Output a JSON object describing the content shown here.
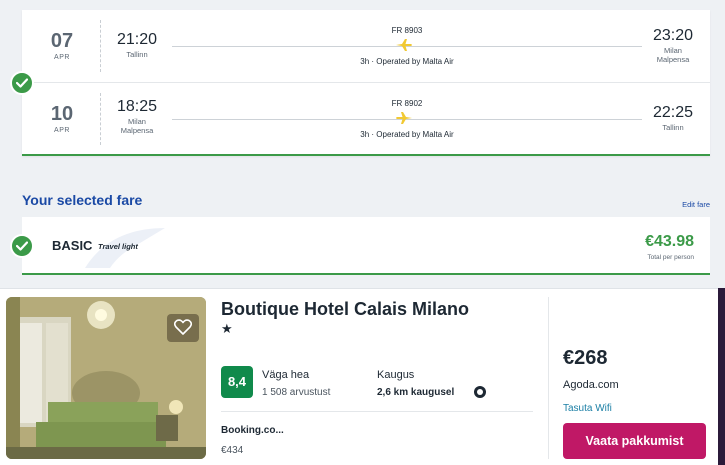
{
  "outbound": {
    "date_day": "07",
    "date_month": "APR",
    "departure_time": "21:20",
    "departure_city": "Tallinn",
    "flight_number": "FR 8903",
    "operated": "3h · Operated by Malta Air",
    "arrival_time": "23:20",
    "arrival_city_line1": "Milan",
    "arrival_city_line2": "Malpensa"
  },
  "return": {
    "date_day": "10",
    "date_month": "APR",
    "departure_time": "18:25",
    "departure_city_line1": "Milan",
    "departure_city_line2": "Malpensa",
    "flight_number": "FR 8902",
    "operated": "3h · Operated by Malta Air",
    "arrival_time": "22:25",
    "arrival_city": "Tallinn"
  },
  "fare": {
    "heading": "Your selected fare",
    "edit_label": "Edit fare",
    "name": "BASIC",
    "subtitle": "Travel light",
    "price": "€43.98",
    "price_note": "Total per person"
  },
  "hotel": {
    "name": "Boutique Hotel Calais Milano",
    "stars": "★",
    "rating_score": "8,4",
    "rating_label": "Väga hea",
    "reviews": "1 508 arvustust",
    "distance_label": "Kaugus",
    "distance_value": "2,6 km kaugusel",
    "provider_name": "Booking.co...",
    "provider_price": "€434",
    "deal_price": "€268",
    "deal_site": "Agoda.com",
    "deal_feature": "Tasuta Wifi",
    "deal_button": "Vaata pakkumist"
  },
  "colors": {
    "accent_green": "#3b9a48",
    "brand_blue": "#1b4aa5",
    "plane_yellow": "#f1c933",
    "rating_green": "#108a4b",
    "deal_button": "#c01866"
  },
  "icons": {
    "check": "check-icon",
    "plane": "plane-icon",
    "heart": "heart-icon",
    "location": "location-icon"
  }
}
